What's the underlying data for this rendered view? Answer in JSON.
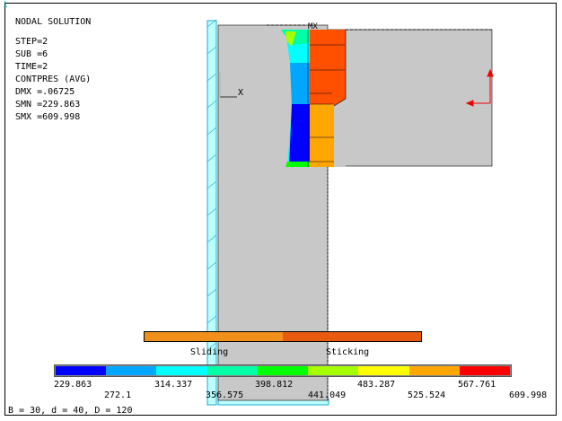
{
  "window": {
    "number": "1"
  },
  "header": {
    "title": "NODAL SOLUTION",
    "step": "STEP=2",
    "sub": "SUB =6",
    "time": "TIME=2",
    "quantity": "CONTPRES (AVG)",
    "dmx": "DMX =.06725",
    "smn": "SMN =229.863",
    "smx": "SMX =609.998"
  },
  "triad": {
    "x_label": "X"
  },
  "model": {
    "mx_label": "MX"
  },
  "status_legend": {
    "sliding_label": "Sliding",
    "sticking_label": "Sticking",
    "sliding_color": "#f0901a",
    "sticking_color": "#e85a10"
  },
  "contour_legend": {
    "colors": [
      "#0000ff",
      "#00a6ff",
      "#00ffff",
      "#00ffa6",
      "#00ff00",
      "#a6ff00",
      "#ffff00",
      "#ffa600",
      "#ff0000"
    ],
    "labels_top": [
      "229.863",
      "314.337",
      "398.812",
      "483.287",
      "567.761"
    ],
    "labels_bottom": [
      "272.1",
      "356.575",
      "441.049",
      "525.524",
      "609.998"
    ]
  },
  "footer": {
    "text": "B = 30, d = 40, D = 120"
  }
}
